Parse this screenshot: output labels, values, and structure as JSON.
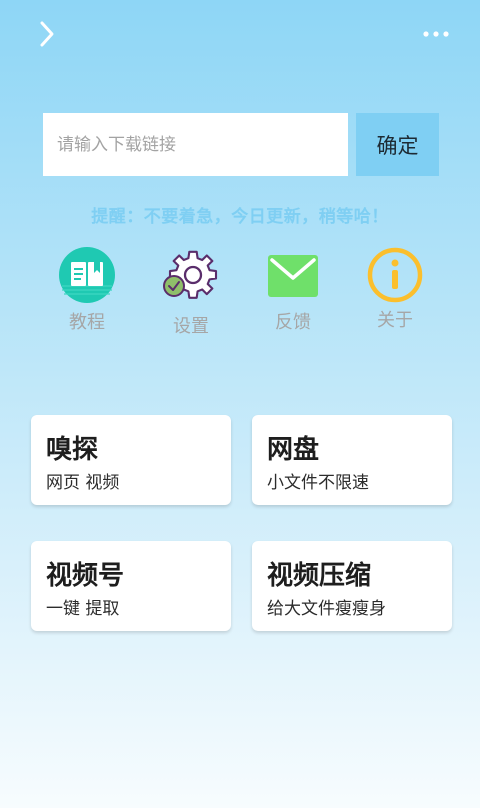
{
  "topbar": {
    "back_icon": "chevron-right-icon",
    "more_icon": "more-dots-icon"
  },
  "search": {
    "placeholder": "请输入下载链接",
    "value": "",
    "confirm_label": "确定"
  },
  "notice": "提醒：不要着急，今日更新，稍等哈！",
  "colors": {
    "accent": "#7fcff3",
    "tutorial": "#1fc9b2",
    "feedback": "#6fe06a",
    "about": "#fbbf2d",
    "settings_stroke": "#5a2d6b",
    "settings_check": "#8fbf6a"
  },
  "shortcuts": [
    {
      "label": "教程",
      "icon": "book-icon"
    },
    {
      "label": "设置",
      "icon": "gear-icon"
    },
    {
      "label": "反馈",
      "icon": "mail-icon"
    },
    {
      "label": "关于",
      "icon": "info-icon"
    }
  ],
  "cards": [
    {
      "title": "嗅探",
      "subtitle": "网页 视频"
    },
    {
      "title": "网盘",
      "subtitle": "小文件不限速"
    },
    {
      "title": "视频号",
      "subtitle": "一键 提取"
    },
    {
      "title": "视频压缩",
      "subtitle": "给大文件瘦瘦身"
    }
  ]
}
